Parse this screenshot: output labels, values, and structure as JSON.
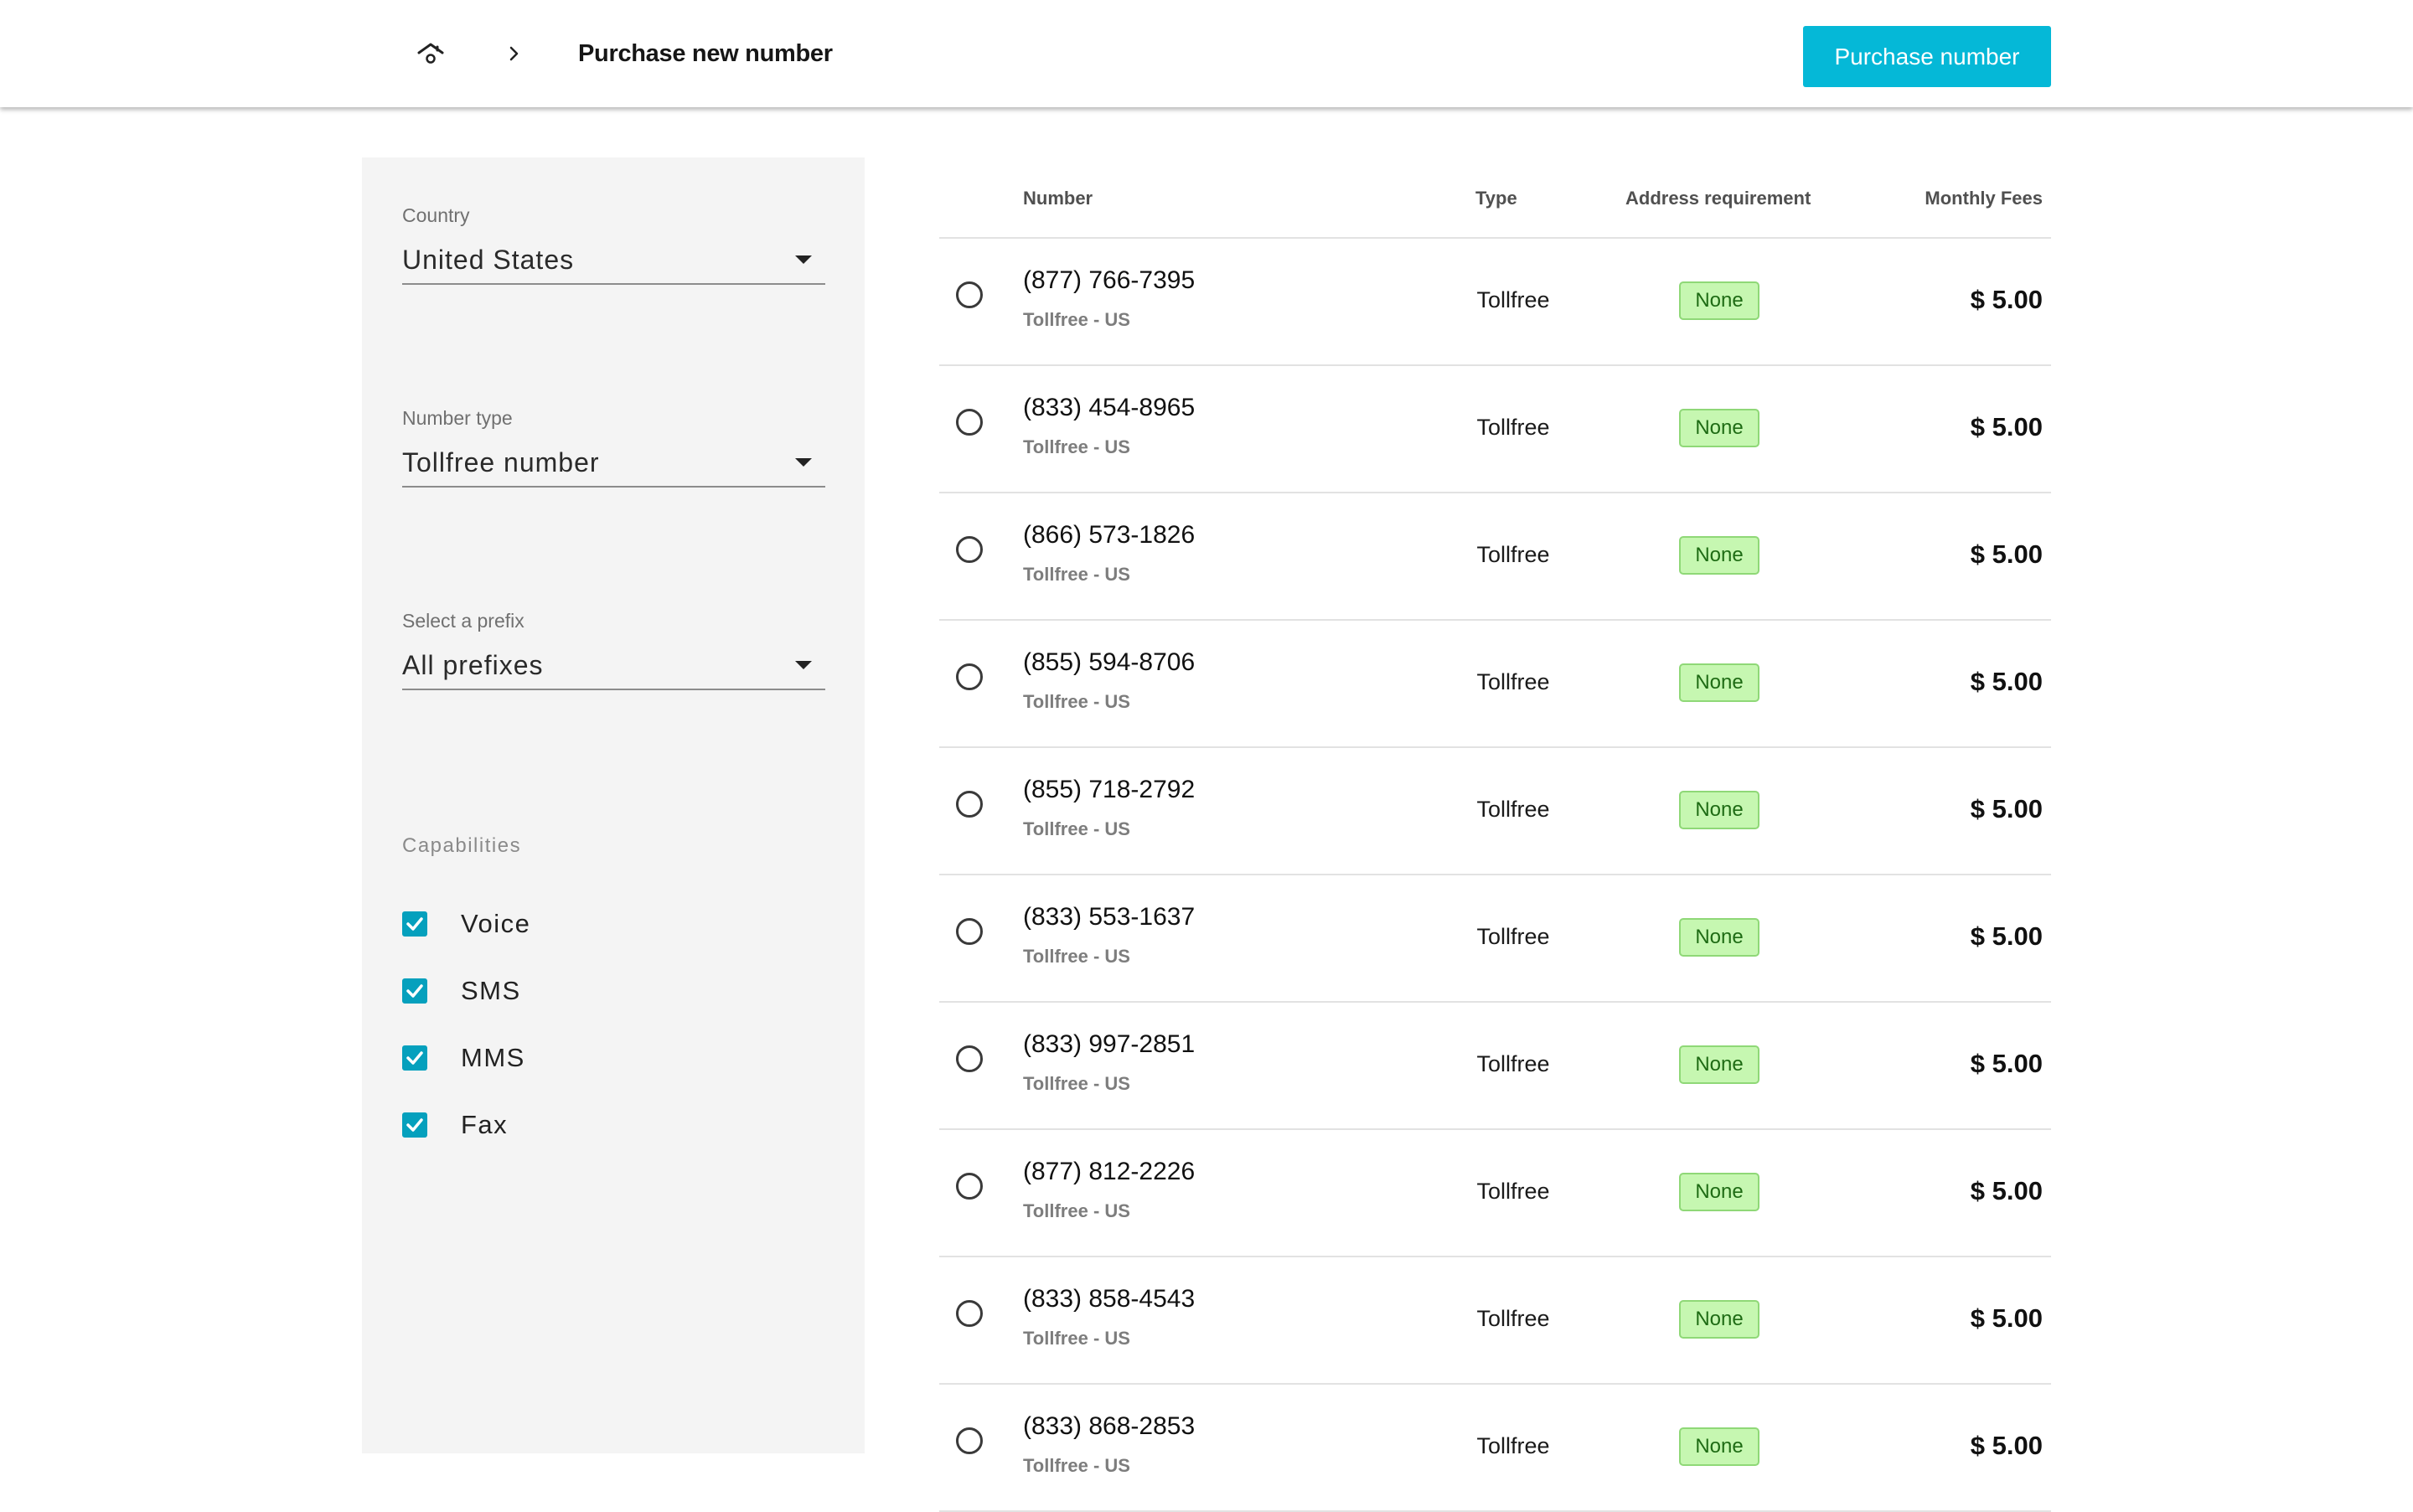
{
  "header": {
    "home_icon": "home-icon",
    "separator_icon": "chevron-right-icon",
    "title": "Purchase new number",
    "purchase_button": "Purchase number",
    "accent_color": "#05b8d7"
  },
  "filters": {
    "country": {
      "label": "Country",
      "value": "United States"
    },
    "number_type": {
      "label": "Number type",
      "value": "Tollfree number"
    },
    "prefix": {
      "label": "Select a prefix",
      "value": "All prefixes"
    },
    "capabilities": {
      "title": "Capabilities",
      "items": [
        {
          "label": "Voice",
          "checked": true
        },
        {
          "label": "SMS",
          "checked": true
        },
        {
          "label": "MMS",
          "checked": true
        },
        {
          "label": "Fax",
          "checked": true
        }
      ]
    }
  },
  "table": {
    "columns": [
      "Number",
      "Type",
      "Address requirement",
      "Monthly Fees"
    ],
    "rows": [
      {
        "number": "(877) 766-7395",
        "sub": "Tollfree - US",
        "type": "Tollfree",
        "address": "None",
        "fee": "$ 5.00"
      },
      {
        "number": "(833) 454-8965",
        "sub": "Tollfree - US",
        "type": "Tollfree",
        "address": "None",
        "fee": "$ 5.00"
      },
      {
        "number": "(866) 573-1826",
        "sub": "Tollfree - US",
        "type": "Tollfree",
        "address": "None",
        "fee": "$ 5.00"
      },
      {
        "number": "(855) 594-8706",
        "sub": "Tollfree - US",
        "type": "Tollfree",
        "address": "None",
        "fee": "$ 5.00"
      },
      {
        "number": "(855) 718-2792",
        "sub": "Tollfree - US",
        "type": "Tollfree",
        "address": "None",
        "fee": "$ 5.00"
      },
      {
        "number": "(833) 553-1637",
        "sub": "Tollfree - US",
        "type": "Tollfree",
        "address": "None",
        "fee": "$ 5.00"
      },
      {
        "number": "(833) 997-2851",
        "sub": "Tollfree - US",
        "type": "Tollfree",
        "address": "None",
        "fee": "$ 5.00"
      },
      {
        "number": "(877) 812-2226",
        "sub": "Tollfree - US",
        "type": "Tollfree",
        "address": "None",
        "fee": "$ 5.00"
      },
      {
        "number": "(833) 858-4543",
        "sub": "Tollfree - US",
        "type": "Tollfree",
        "address": "None",
        "fee": "$ 5.00"
      },
      {
        "number": "(833) 868-2853",
        "sub": "Tollfree - US",
        "type": "Tollfree",
        "address": "None",
        "fee": "$ 5.00"
      }
    ]
  }
}
